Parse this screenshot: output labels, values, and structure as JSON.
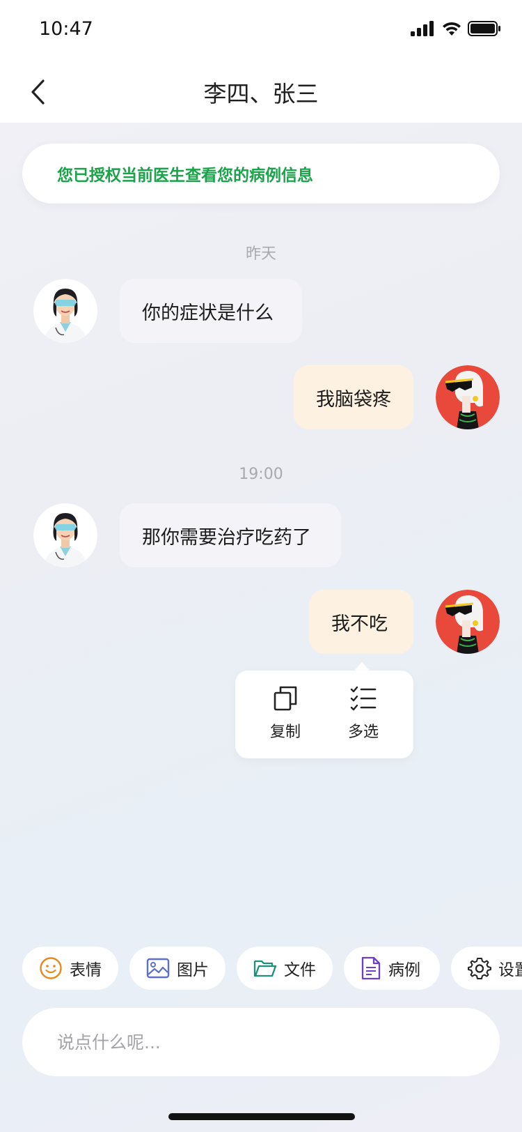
{
  "status_bar": {
    "time": "10:47"
  },
  "nav": {
    "title": "李四、张三"
  },
  "notice": {
    "text": "您已授权当前医生查看您的病例信息"
  },
  "messages": [
    {
      "type": "time",
      "text": "昨天"
    },
    {
      "type": "incoming",
      "sender": "doctor",
      "text": "你的症状是什么"
    },
    {
      "type": "outgoing",
      "sender": "patient",
      "text": "我脑袋疼"
    },
    {
      "type": "time",
      "text": "19:00"
    },
    {
      "type": "incoming",
      "sender": "doctor",
      "text": "那你需要治疗吃药了"
    },
    {
      "type": "outgoing",
      "sender": "patient",
      "text": "我不吃"
    }
  ],
  "context_menu": {
    "copy_label": "复制",
    "multiselect_label": "多选"
  },
  "toolbar": {
    "items": [
      {
        "label": "表情",
        "icon": "smiley-icon",
        "color": "#e8891c"
      },
      {
        "label": "图片",
        "icon": "image-icon",
        "color": "#5b6fd6"
      },
      {
        "label": "文件",
        "icon": "folder-icon",
        "color": "#1f8f7a"
      },
      {
        "label": "病例",
        "icon": "document-icon",
        "color": "#6b3fc8"
      },
      {
        "label": "设置",
        "icon": "gear-icon",
        "color": "#222222"
      }
    ]
  },
  "input": {
    "placeholder": "说点什么呢..."
  },
  "colors": {
    "notice_text": "#1aa34a",
    "incoming_bubble": "#f4f4f8",
    "outgoing_bubble": "#fdf1e2"
  }
}
